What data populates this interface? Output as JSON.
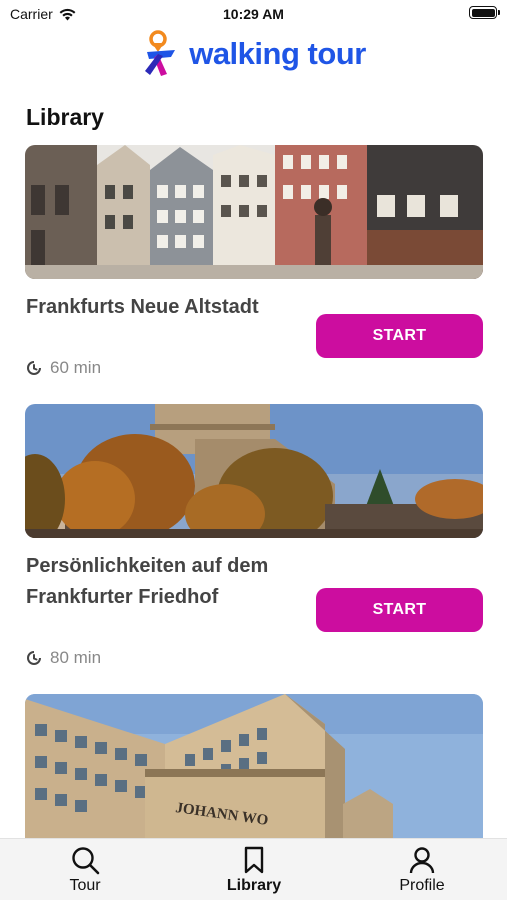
{
  "status_bar": {
    "carrier": "Carrier",
    "time": "10:29 AM",
    "icons": [
      "wifi-icon",
      "battery-icon"
    ]
  },
  "header": {
    "logo_text": "walking tour",
    "logo_icon": "walking-person-pin-icon",
    "brand_color": "#1f55e6"
  },
  "library": {
    "title": "Library",
    "accent_color": "#cc0d9f",
    "tours": [
      {
        "title": "Frankfurts Neue Altstadt",
        "duration": "60 min",
        "start_label": "START"
      },
      {
        "title": "Persönlichkeiten auf dem Frankfurter Friedhof",
        "duration": "80 min",
        "start_label": "START"
      }
    ],
    "partial_card_sign": "JOHANN WO"
  },
  "tab_bar": {
    "tabs": [
      {
        "label": "Tour",
        "icon": "search-icon",
        "active": false
      },
      {
        "label": "Library",
        "icon": "bookmark-icon",
        "active": true
      },
      {
        "label": "Profile",
        "icon": "person-icon",
        "active": false
      }
    ]
  }
}
